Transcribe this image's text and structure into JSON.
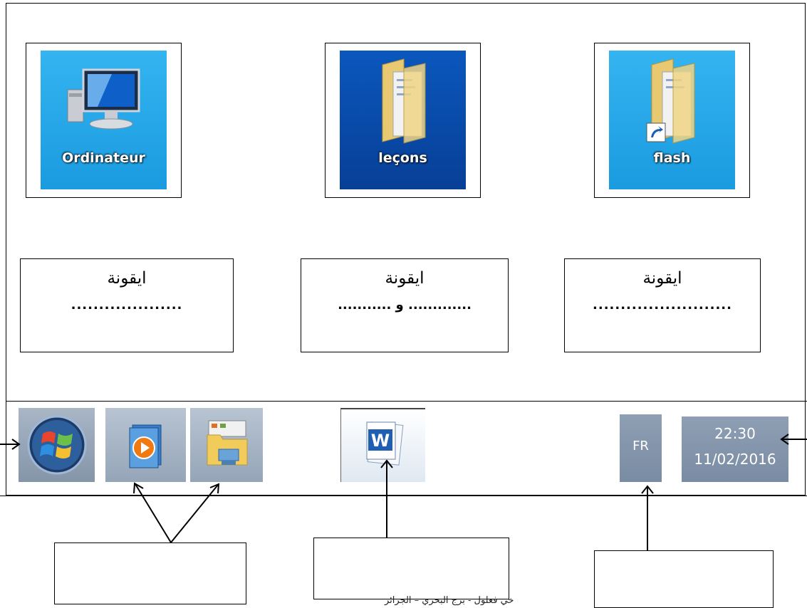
{
  "desktop_icons": [
    {
      "label": "Ordinateur",
      "icon": "computer-icon"
    },
    {
      "label": "leçons",
      "icon": "folder-icon"
    },
    {
      "label": "flash",
      "icon": "folder-shortcut-icon"
    }
  ],
  "answer_boxes": [
    {
      "title": "ايقونة",
      "blank": "...................."
    },
    {
      "title": "ايقونة",
      "blank": "............. و  ..........."
    },
    {
      "title": "ايقونة",
      "blank": "........................."
    }
  ],
  "taskbar": {
    "start_icon": "windows-start-icon",
    "pinned": [
      "media-player-icon",
      "file-explorer-icon"
    ],
    "word_icon": "word-icon",
    "language": "FR",
    "time": "22:30",
    "date": "11/02/2016"
  },
  "footer_caption": "خي فعلول  - برج البحري – الجزائر",
  "colors": {
    "tile_blue": "#1ca3e8",
    "tile_dark_blue": "#0a4fb0",
    "taskbar_gray": "#8a9bb0"
  }
}
